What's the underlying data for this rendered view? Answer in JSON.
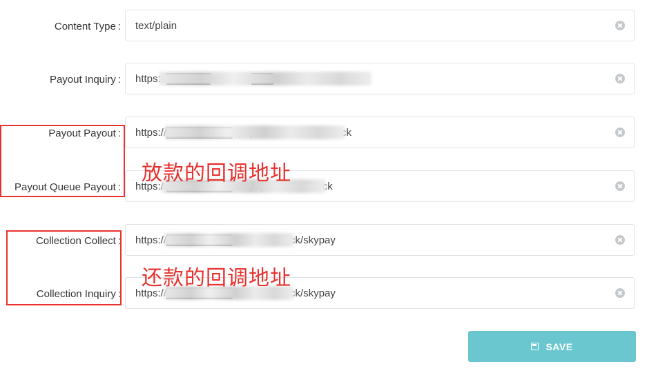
{
  "form": {
    "fields": [
      {
        "label": "Content Type",
        "value": "text/plain"
      },
      {
        "label": "Payout Inquiry",
        "value": "https://██████.com/call███offlineOrderCallback"
      },
      {
        "label": "Payout Payout",
        "value": "https://█████████epay/offlineOrderCallback"
      },
      {
        "label": "Payout Queue Payout",
        "value": "https://█████████eecpay/orderCallback"
      },
      {
        "label": "Collection Collect",
        "value": "https://█████████clover/callback/skypay"
      },
      {
        "label": "Collection Inquiry",
        "value": "https://█████████clover/callback/skypay"
      }
    ],
    "colon": ":",
    "save_label": "SAVE"
  },
  "annotations": {
    "payout_note": "放款的回调地址",
    "collection_note": "还款的回调地址"
  },
  "colors": {
    "annotation": "#e8322f",
    "save_button": "#6bc7cf",
    "field_border": "#dfe3e8"
  },
  "icons": {
    "clear": "clear-icon",
    "save": "save-icon"
  }
}
